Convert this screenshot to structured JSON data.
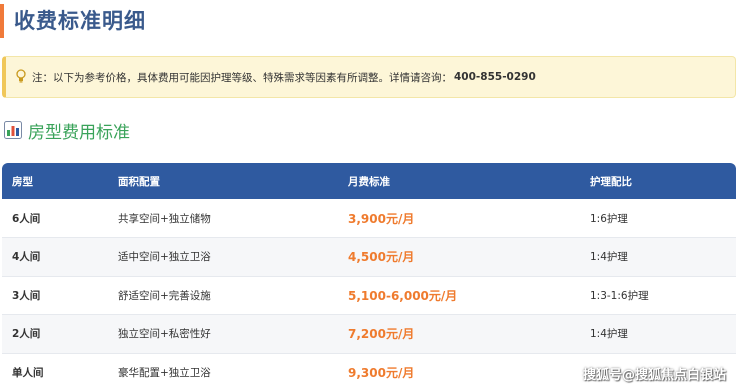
{
  "page": {
    "title": "收费标准明细"
  },
  "notice": {
    "icon": "lightbulb-icon",
    "text": "注：以下为参考价格，具体费用可能因护理等级、特殊需求等因素有所调整。详情请咨询：",
    "phone": "400-855-0290"
  },
  "section": {
    "icon": "bar-chart-icon",
    "title": "房型费用标准"
  },
  "table": {
    "headers": [
      "房型",
      "面积配置",
      "月费标准",
      "护理配比"
    ],
    "rows": [
      {
        "room": "6人间",
        "config": "共享空间+独立储物",
        "fee": "3,900元/月",
        "ratio": "1:6护理"
      },
      {
        "room": "4人间",
        "config": "适中空间+独立卫浴",
        "fee": "4,500元/月",
        "ratio": "1:4护理"
      },
      {
        "room": "3人间",
        "config": "舒适空间+完善设施",
        "fee": "5,100-6,000元/月",
        "ratio": "1:3-1:6护理"
      },
      {
        "room": "2人间",
        "config": "独立空间+私密性好",
        "fee": "7,200元/月",
        "ratio": "1:4护理"
      },
      {
        "room": "单人间",
        "config": "豪华配置+独立卫浴",
        "fee": "9,300元/月",
        "ratio": ""
      }
    ]
  },
  "watermark": "搜狐号@搜狐焦点白银站",
  "colors": {
    "title": "#3a5a8c",
    "accent_bar": "#f07a3a",
    "notice_bg": "#fdf6d8",
    "section_title": "#3aa35a",
    "table_header": "#2f5aa0",
    "fee": "#ef7b2e"
  }
}
